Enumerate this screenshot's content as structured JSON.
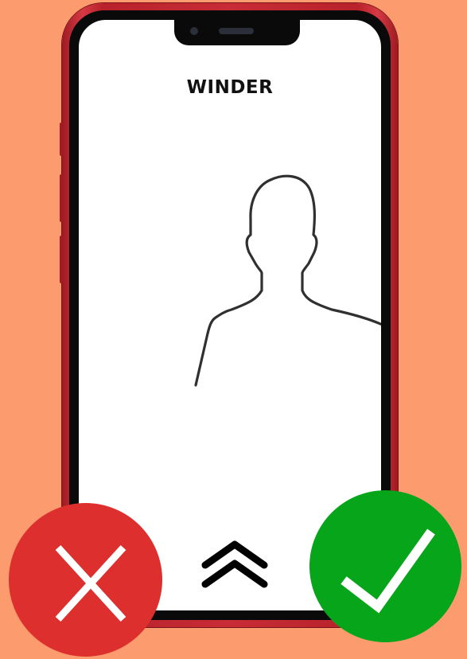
{
  "call": {
    "caller_name": "WINDER"
  },
  "icons": {
    "avatar": "person-silhouette-icon",
    "swipe_up": "double-chevron-up-icon",
    "decline": "x-icon",
    "accept": "checkmark-icon"
  },
  "colors": {
    "background": "#fc9c6e",
    "phone_frame": "#c82c36",
    "decline": "#de2f2f",
    "accept": "#07a51a"
  }
}
